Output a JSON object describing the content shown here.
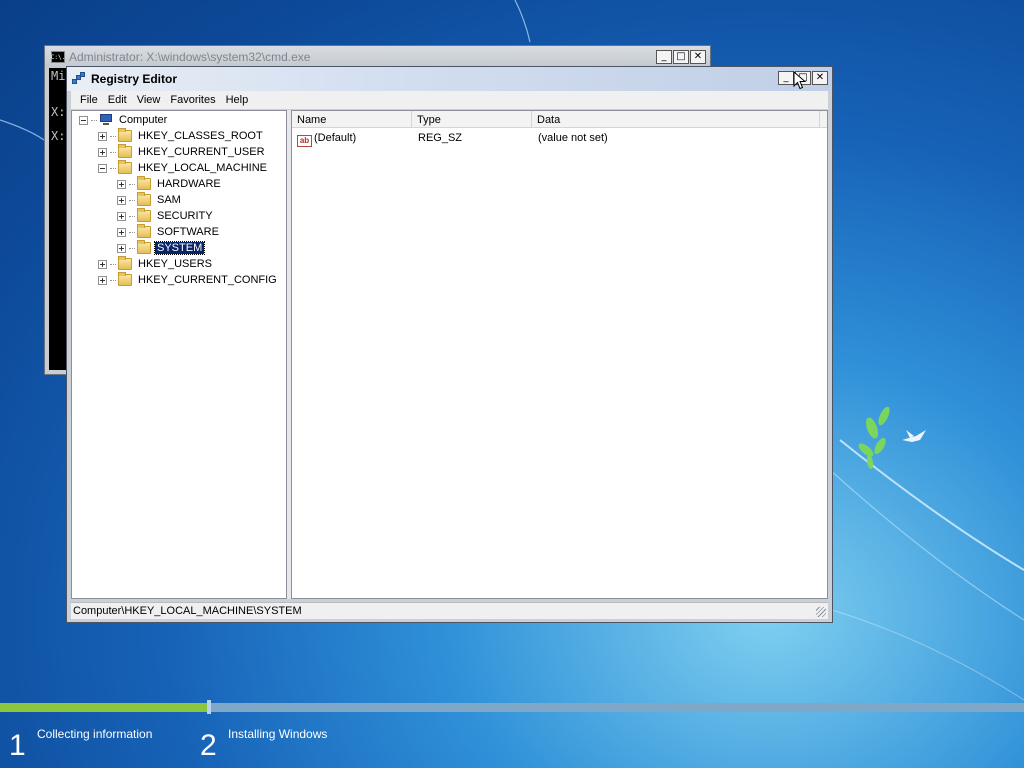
{
  "cmd_window": {
    "title": "Administrator: X:\\windows\\system32\\cmd.exe",
    "icon_text": "C:\\.",
    "lines": [
      "Mi",
      "",
      "",
      "X:",
      "",
      "X:"
    ]
  },
  "registry_editor": {
    "title": "Registry Editor",
    "menu": [
      "File",
      "Edit",
      "View",
      "Favorites",
      "Help"
    ],
    "tree": {
      "root": "Computer",
      "hives": [
        {
          "label": "HKEY_CLASSES_ROOT"
        },
        {
          "label": "HKEY_CURRENT_USER"
        },
        {
          "label": "HKEY_LOCAL_MACHINE"
        },
        {
          "label": "HARDWARE"
        },
        {
          "label": "SAM"
        },
        {
          "label": "SECURITY"
        },
        {
          "label": "SOFTWARE"
        },
        {
          "label": "SYSTEM"
        },
        {
          "label": "HKEY_USERS"
        },
        {
          "label": "HKEY_CURRENT_CONFIG"
        }
      ],
      "selected": "SYSTEM"
    },
    "columns": [
      "Name",
      "Type",
      "Data"
    ],
    "values": [
      {
        "name": "(Default)",
        "type": "REG_SZ",
        "data": "(value not set)",
        "icon": "ab"
      }
    ],
    "status": "Computer\\HKEY_LOCAL_MACHINE\\SYSTEM"
  },
  "setup_progress": {
    "steps": [
      {
        "number": "1",
        "label": "Collecting information"
      },
      {
        "number": "2",
        "label": "Installing Windows"
      }
    ],
    "step2_progress_pct": 0
  },
  "colors": {
    "progress_green": "#8cc63f",
    "selection": "#0a246a"
  }
}
